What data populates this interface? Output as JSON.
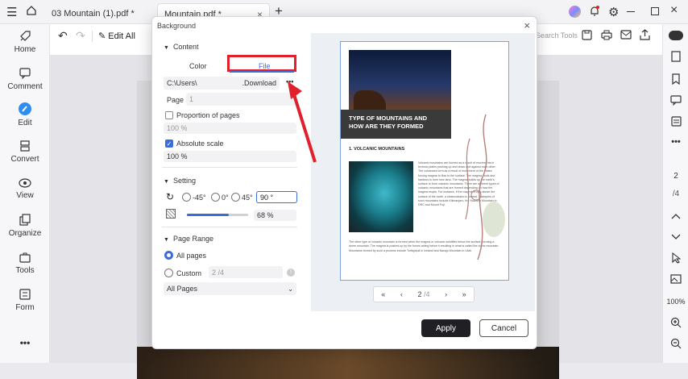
{
  "titlebar": {
    "tabs": [
      {
        "label": "03 Mountain (1).pdf *"
      },
      {
        "label": "Mountain.pdf *"
      }
    ],
    "new_tab": "+"
  },
  "toolbar": {
    "edit_all_label": "Edit All",
    "search_placeholder": "Search Tools"
  },
  "left_rail": {
    "items": [
      {
        "label": "Home",
        "icon": "rocket-icon"
      },
      {
        "label": "Comment",
        "icon": "comment-icon"
      },
      {
        "label": "Edit",
        "icon": "edit-icon"
      },
      {
        "label": "Convert",
        "icon": "convert-icon"
      },
      {
        "label": "View",
        "icon": "view-icon"
      },
      {
        "label": "Organize",
        "icon": "organize-icon"
      },
      {
        "label": "Tools",
        "icon": "tools-icon"
      },
      {
        "label": "Form",
        "icon": "form-icon"
      },
      {
        "label": "•••",
        "icon": "more-icon"
      }
    ]
  },
  "right_rail": {
    "zoom": "100%"
  },
  "dialog": {
    "title": "Background",
    "close": "×",
    "content_section": "Content",
    "tab_color": "Color",
    "tab_file": "File",
    "file_path_left": "C:\\Users\\",
    "file_path_right": ".Download",
    "browse": "•••",
    "page_label": "Page",
    "page_value": "1",
    "proportion_label": "Proportion of pages",
    "proportion_value": "100 %",
    "absolute_scale_label": "Absolute scale",
    "absolute_scale_value": "100 %",
    "setting_section": "Setting",
    "rot_neg45": "-45°",
    "rot_0": "0°",
    "rot_45": "45°",
    "rotation_value": "90 °",
    "opacity_value": "68 %",
    "opacity_level": 0.68,
    "page_range_section": "Page Range",
    "all_pages_label": "All pages",
    "custom_label": "Custom",
    "custom_value": "2 /4",
    "range_select": "All Pages",
    "apply": "Apply",
    "cancel": "Cancel"
  },
  "preview": {
    "heading": "TYPE OF MOUNTAINS AND HOW ARE THEY FORMED",
    "subheading": "1. VOLCANIC MOUNTAINS",
    "body_right": "Volcanic mountains are formed as a result of movements in tectonic plates pushing up and down and against each other. The volcanoes form as a result of movement of the plates forcing magma to flow to the surface. The magma cools and hardens to form new land. The magma builds up the earth's surface to form volcanic mountains. There are different types of volcanic mountains that are formed depending on how the magma erupts. For instance, if the magma erupts above the surface of the earth, a stratovolcano is formed. Examples of such mountains include Kilimanjaro, the Nuwarra Mountain in DRC and Mount Fuji.",
    "body_bottom": "The other type of volcanic mountain is formed when the magma or volcanic solidifies below the surface, forming a dome mountain. The magma is pushed up by the forces acting below it resulting in what is called the dome mountain. Mountains formed by such a process include Torfajokull in Iceland and Navajo Mountain in Utah.",
    "page_current": "2",
    "page_total": "/4"
  },
  "colors": {
    "accent": "#3d6cd9",
    "highlight": "#e0202a",
    "dark_band": "#3a3a3a"
  }
}
